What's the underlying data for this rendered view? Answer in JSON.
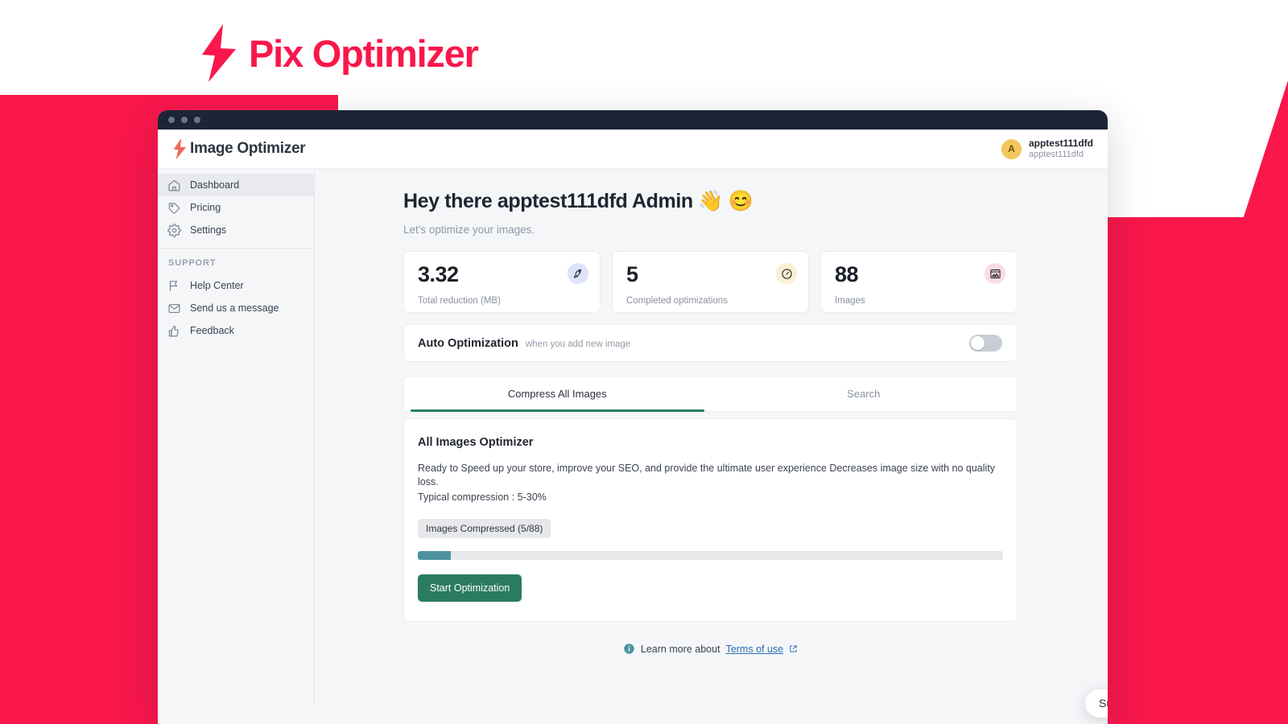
{
  "brand": {
    "name": "Pix Optimizer",
    "icon": "lightning-bolt-icon",
    "color": "#F9174B"
  },
  "window": {
    "titlebar_dots": 3
  },
  "appbar": {
    "logo_icon": "lightning-bolt-icon",
    "title": "Image Optimizer",
    "account": {
      "avatar_initial": "A",
      "name": "apptest111dfd",
      "subtitle": "apptest111dfd"
    }
  },
  "sidebar": {
    "items": [
      {
        "label": "Dashboard",
        "icon": "home-icon",
        "active": true
      },
      {
        "label": "Pricing",
        "icon": "tag-icon",
        "active": false
      },
      {
        "label": "Settings",
        "icon": "gear-icon",
        "active": false
      }
    ],
    "support_title": "SUPPORT",
    "support_items": [
      {
        "label": "Help Center",
        "icon": "flag-icon"
      },
      {
        "label": "Send us a message",
        "icon": "envelope-icon"
      },
      {
        "label": "Feedback",
        "icon": "thumbs-up-icon"
      }
    ]
  },
  "main": {
    "greeting": "Hey there apptest111dfd Admin 👋 😊",
    "subtitle": "Let's optimize your images.",
    "stats": [
      {
        "value": "3.32",
        "label": "Total reduction (MB)",
        "icon": "rocket-icon",
        "bg": "#DCE3FB"
      },
      {
        "value": "5",
        "label": "Completed optimizations",
        "icon": "gauge-icon",
        "bg": "#FBF0D4"
      },
      {
        "value": "88",
        "label": "Images",
        "icon": "image-icon",
        "bg": "#FADCE4"
      }
    ],
    "auto_optimization": {
      "title": "Auto Optimization",
      "subtitle": "when you add new image",
      "toggle_state": "off"
    },
    "tabs": [
      {
        "label": "Compress All Images",
        "active": true
      },
      {
        "label": "Search",
        "active": false
      }
    ],
    "panel": {
      "title": "All Images Optimizer",
      "description_line1": "Ready to Speed up your store, improve your SEO, and provide the ultimate user experience Decreases image size with no quality loss.",
      "description_line2": "Typical compression : 5-30%",
      "chip": "Images Compressed (5/88)",
      "progress_percent": 5.7,
      "button": "Start Optimization"
    },
    "footer": {
      "info_icon": "info-circle-icon",
      "text": "Learn more about",
      "link": "Terms of use",
      "external_icon": "external-link-icon"
    }
  },
  "chat": {
    "pill_text": "Support Team 👋",
    "button_icon": "chat-bubble-icon"
  },
  "colors": {
    "brand_red": "#F9174B",
    "accent_green": "#2B7C5E",
    "tab_underline": "#2B7C63",
    "progress_fill": "#4E92A0",
    "titlebar": "#1C2537"
  }
}
